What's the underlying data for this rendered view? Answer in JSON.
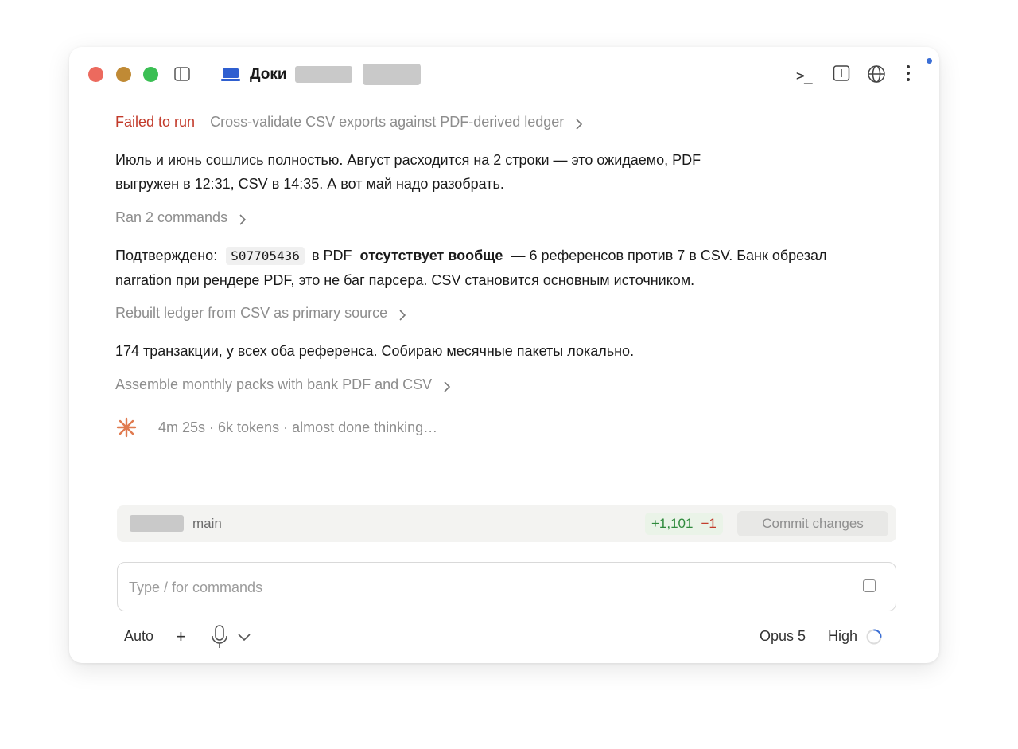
{
  "window": {
    "title": "Доки",
    "icons": [
      "sidebar-toggle-icon",
      "folder-icon",
      "terminal-icon",
      "panel-icon",
      "globe-icon",
      "more-vertical-icon"
    ],
    "terminal_glyph": ">_"
  },
  "transcript": {
    "failed_status": "Failed to run",
    "failed_step": "Cross-validate CSV exports against PDF-derived ledger",
    "para1": "Июль и июнь сошлись полностью. Август расходится на 2 строки — это ожидаемо, PDF выгружен в 12:31, CSV в 14:35. А вот май надо разобрать.",
    "ran_commands": "Ran 2 commands",
    "para2_prefix": "Подтверждено:",
    "para2_code": "S07705436",
    "para2_mid": "в PDF",
    "para2_bold": "отсутствует вообще",
    "para2_suffix": "— 6 референсов против 7 в CSV. Банк обрезал narration при рендере PDF, это не баг парсера. CSV становится основным источником.",
    "step_rebuilt": "Rebuilt ledger from CSV as primary source",
    "para3": "174 транзакции, у всех оба референса. Собираю месячные пакеты локально.",
    "step_assemble": "Assemble monthly packs with bank PDF and CSV",
    "thinking": "4m 25s · 6k tokens · almost done thinking…"
  },
  "git_bar": {
    "branch": "main",
    "additions": "+1,101",
    "deletions": "−1",
    "commit_label": "Commit changes"
  },
  "composer": {
    "placeholder": "Type / for commands",
    "value": ""
  },
  "footer": {
    "mode": "Auto",
    "add": "+",
    "model": "Opus 5",
    "effort": "High"
  },
  "colors": {
    "failed": "#c23a2a",
    "muted": "#8d8d8d",
    "additions": "#2f8a3c",
    "deletions": "#c23a2a",
    "accent_blue": "#3b6fd6",
    "spark": "#e07a4f"
  }
}
